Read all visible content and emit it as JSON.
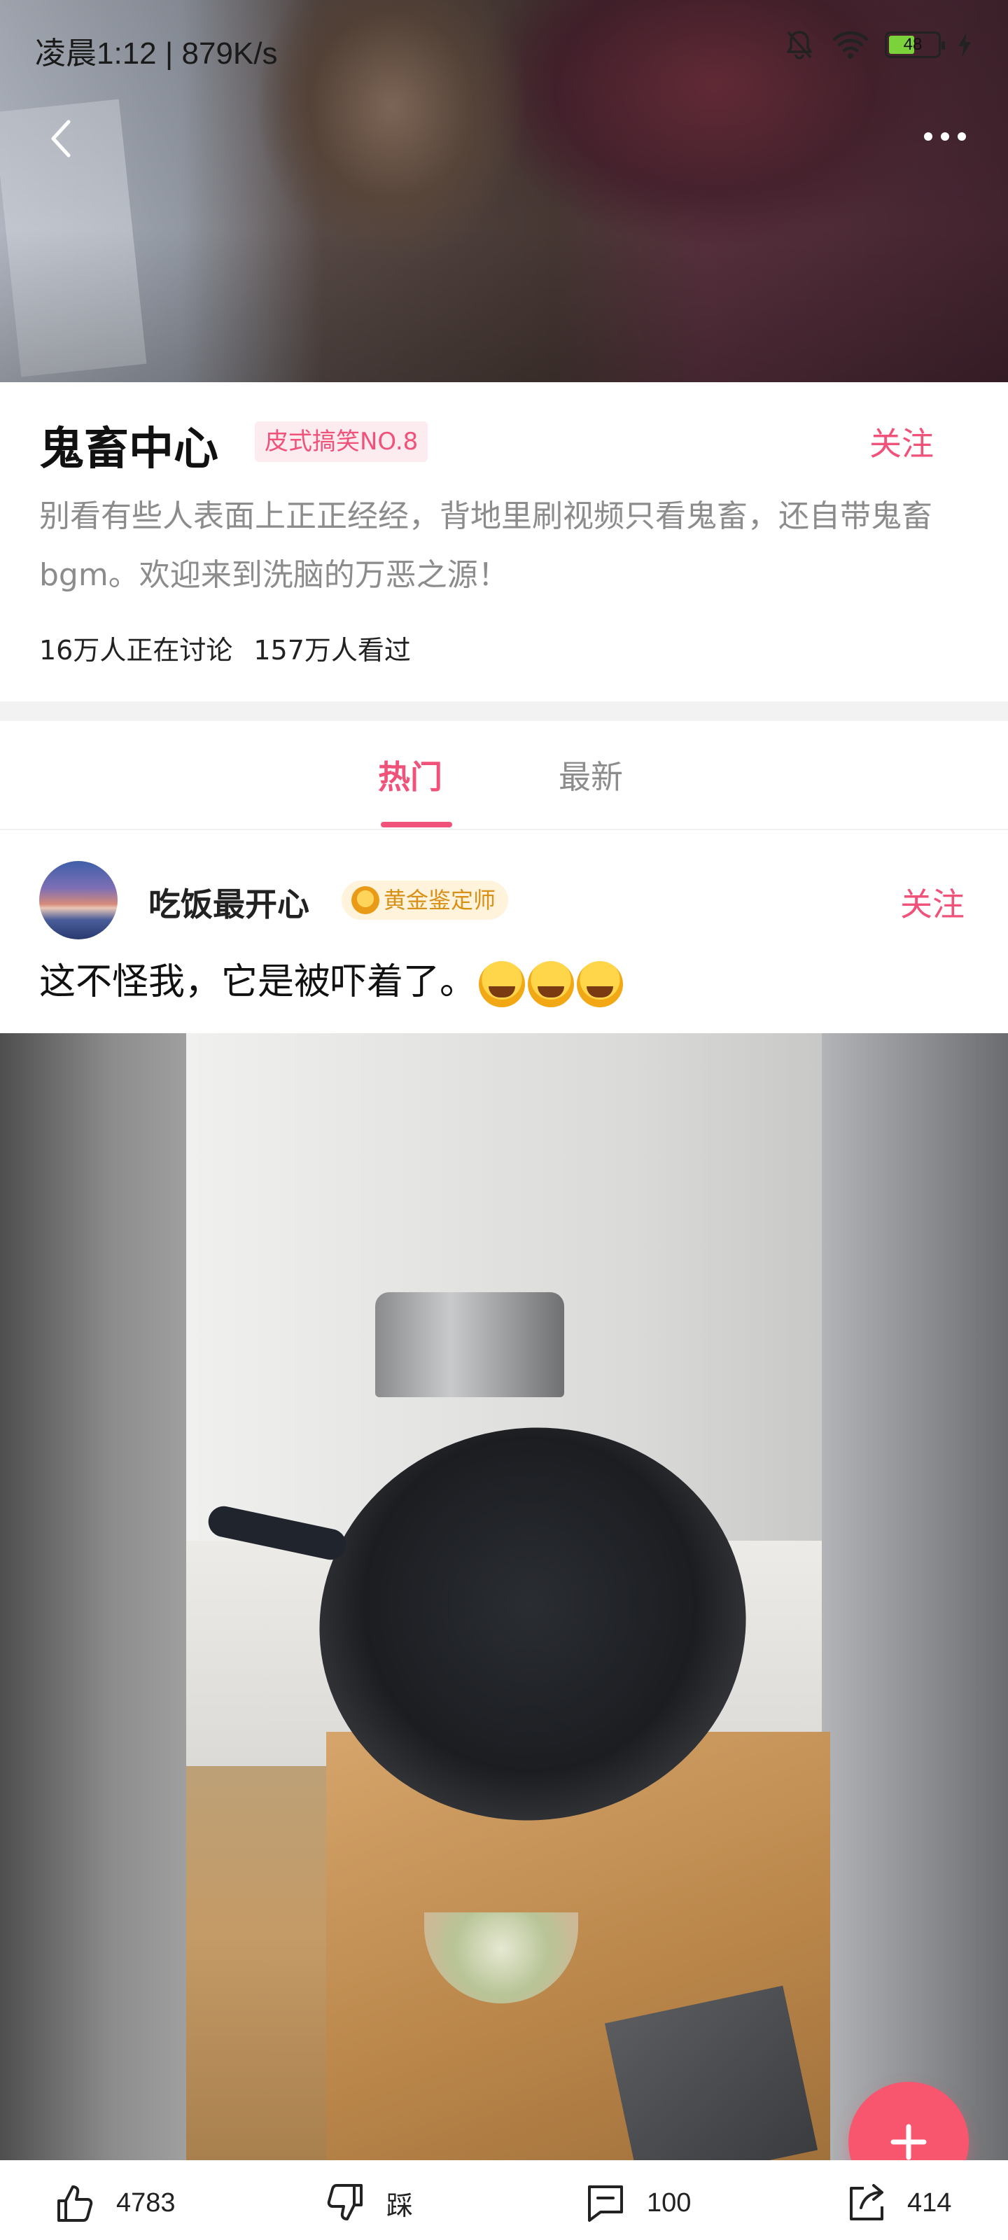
{
  "status_bar": {
    "time_speed": "凌晨1:12 | 879K/s",
    "battery": "48"
  },
  "topic": {
    "title": "鬼畜中心",
    "badge": "皮式搞笑NO.8",
    "follow_label": "关注",
    "description": "别看有些人表面上正正经经，背地里刷视频只看鬼畜，还自带鬼畜bgm。欢迎来到洗脑的万恶之源！",
    "stat_discussing": "16万人正在讨论",
    "stat_viewed": "157万人看过"
  },
  "tabs": [
    {
      "label": "热门",
      "active": true
    },
    {
      "label": "最新",
      "active": false
    }
  ],
  "post": {
    "username": "吃饭最开心",
    "medal": "黄金鉴定师",
    "follow_label": "关注",
    "text": "这不怪我，它是被吓着了。",
    "emoji_count": 3
  },
  "actions": {
    "like_count": "4783",
    "dislike_label": "踩",
    "comment_count": "100",
    "share_count": "414"
  },
  "colors": {
    "accent": "#f0527a",
    "fab": "#f7566e",
    "badge_bg": "#fdecef",
    "medal_text": "#d89016",
    "muted_text": "#8c8c8c"
  },
  "icons": {
    "back": "chevron-left-icon",
    "more": "more-dots-icon",
    "like": "thumbs-up-icon",
    "dislike": "thumbs-down-icon",
    "comment": "comment-icon",
    "share": "share-icon",
    "fab": "plus-icon",
    "medal": "medal-icon"
  }
}
